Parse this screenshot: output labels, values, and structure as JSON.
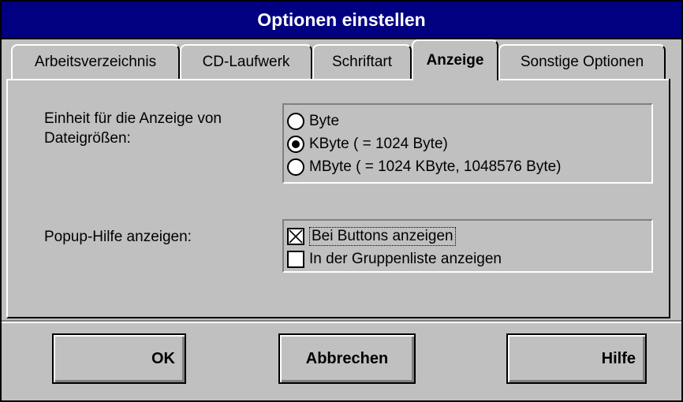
{
  "window": {
    "title": "Optionen einstellen"
  },
  "tabs": [
    {
      "label": "Arbeitsverzeichnis",
      "active": false
    },
    {
      "label": "CD-Laufwerk",
      "active": false
    },
    {
      "label": "Schriftart",
      "active": false
    },
    {
      "label": "Anzeige",
      "active": true
    },
    {
      "label": "Sonstige Optionen",
      "active": false
    }
  ],
  "display": {
    "size_unit_label_line1": "Einheit für die Anzeige von",
    "size_unit_label_line2": "Dateigrößen:",
    "size_units": [
      {
        "label": "Byte",
        "selected": false
      },
      {
        "label": "KByte ( = 1024 Byte)",
        "selected": true
      },
      {
        "label": "MByte ( = 1024 KByte, 1048576 Byte)",
        "selected": false
      }
    ],
    "popup_help_label": "Popup-Hilfe anzeigen:",
    "popup_options": [
      {
        "label": "Bei Buttons anzeigen",
        "checked": true
      },
      {
        "label": "In der Gruppenliste anzeigen",
        "checked": false
      }
    ]
  },
  "buttons": {
    "ok": "OK",
    "cancel": "Abbrechen",
    "help": "Hilfe"
  },
  "colors": {
    "titlebar": "#000080",
    "face": "#c0c0c0"
  }
}
